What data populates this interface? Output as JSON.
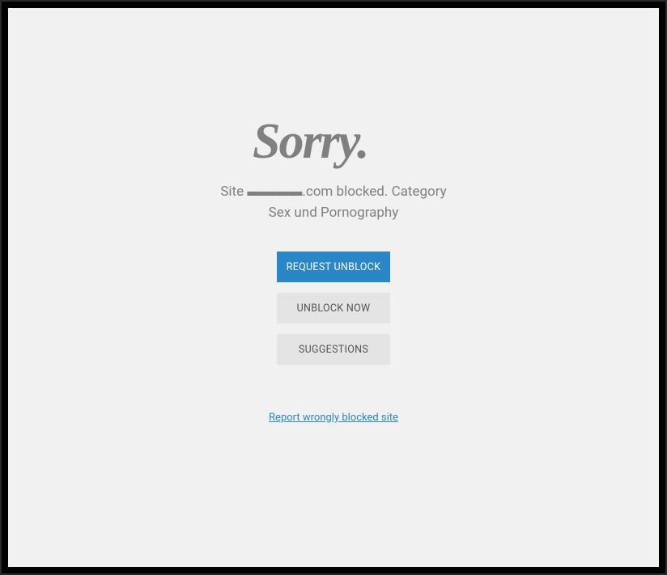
{
  "heading": "Sorry.",
  "message": "Site ▬▬▬▬.com blocked. Category Sex und Pornography",
  "buttons": {
    "request_unblock": "REQUEST UNBLOCK",
    "unblock_now": "UNBLOCK NOW",
    "suggestions": "SUGGESTIONS"
  },
  "report_link": "Report wrongly blocked site",
  "colors": {
    "background": "#f1f1f1",
    "frame": "#000",
    "primary_button": "#2986c7",
    "secondary_button": "#e4e4e4",
    "text_gray": "#808080",
    "link": "#2986c7"
  }
}
